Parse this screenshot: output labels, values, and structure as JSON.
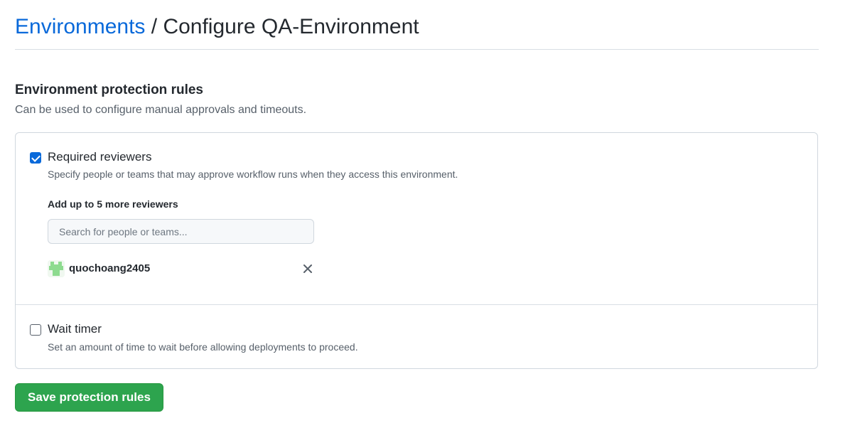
{
  "header": {
    "breadcrumb_link": "Environments",
    "separator": " / ",
    "title": "Configure QA-Environment"
  },
  "section": {
    "title": "Environment protection rules",
    "description": "Can be used to configure manual approvals and timeouts."
  },
  "rules": {
    "required_reviewers": {
      "checked": true,
      "title": "Required reviewers",
      "description": "Specify people or teams that may approve workflow runs when they access this environment.",
      "field_label": "Add up to 5 more reviewers",
      "search_placeholder": "Search for people or teams...",
      "search_value": "",
      "reviewers": [
        {
          "name": "quochoang2405",
          "avatar_icon": "identicon-avatar"
        }
      ]
    },
    "wait_timer": {
      "checked": false,
      "title": "Wait timer",
      "description": "Set an amount of time to wait before allowing deployments to proceed."
    }
  },
  "actions": {
    "save_label": "Save protection rules"
  },
  "colors": {
    "link": "#0969da",
    "checkbox_checked": "#0969da",
    "primary_button": "#2da44e",
    "avatar_fill": "#8ddb8f"
  }
}
